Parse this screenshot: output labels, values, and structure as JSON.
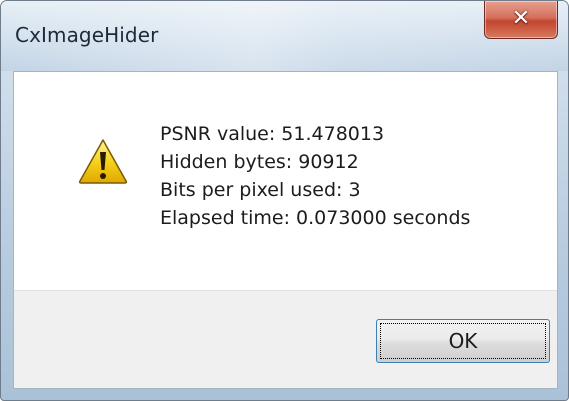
{
  "window": {
    "title": "CxImageHider",
    "close_glyph": "✕"
  },
  "message": {
    "icon": "warning-icon",
    "lines": [
      "PSNR value: 51.478013",
      "Hidden bytes: 90912",
      "Bits per pixel used: 3",
      "Elapsed time: 0.073000 seconds"
    ]
  },
  "buttons": {
    "ok_label": "OK"
  },
  "colors": {
    "warning_fill": "#f6d21c",
    "warning_outline": "#7a5a00",
    "close_button": "#c2452f"
  }
}
